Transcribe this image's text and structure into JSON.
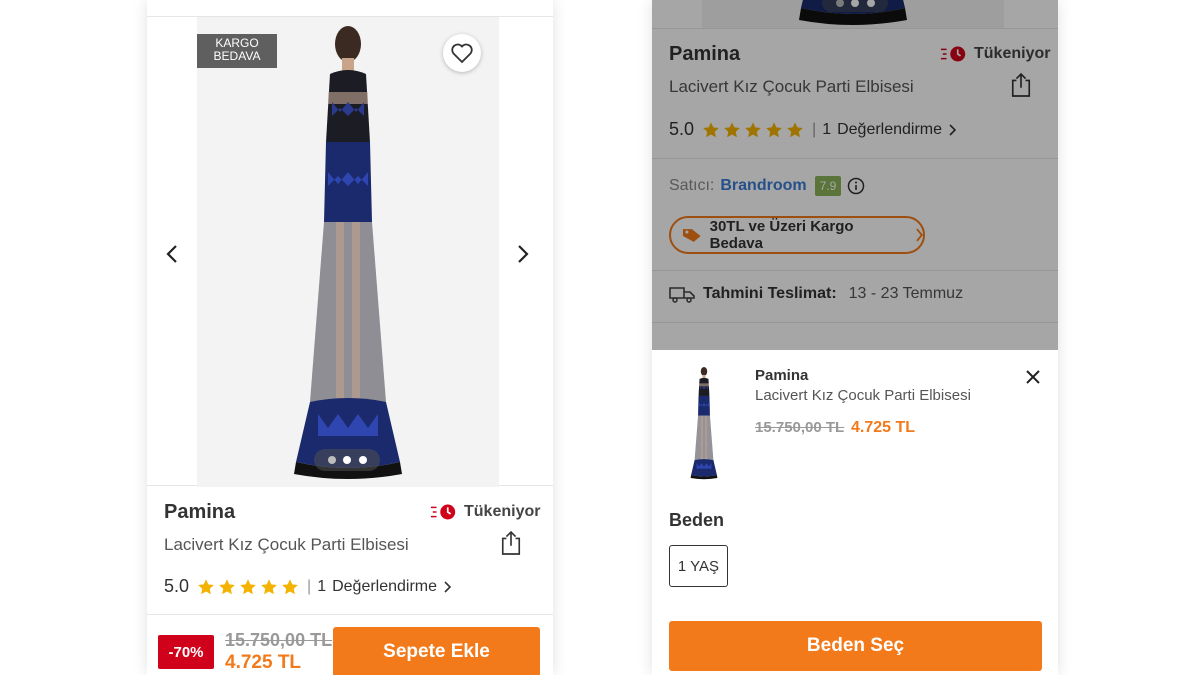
{
  "left": {
    "badge": {
      "line1": "KARGO",
      "line2": "BEDAVA"
    },
    "brand": "Pamina",
    "title": "Lacivert Kız Çocuk Parti Elbisesi",
    "stock_label": "Tükeniyor",
    "rating": {
      "value": "5.0",
      "stars": 5,
      "review_count": "1",
      "review_label": "Değerlendirme"
    },
    "discount": "-70%",
    "old_price": "15.750,00 TL",
    "new_price": "4.725 TL",
    "add_to_cart": "Sepete Ekle",
    "carousel": {
      "slides": 3,
      "active": 1
    }
  },
  "right": {
    "brand": "Pamina",
    "title": "Lacivert Kız Çocuk Parti Elbisesi",
    "stock_label": "Tükeniyor",
    "rating": {
      "value": "5.0",
      "stars": 5,
      "review_count": "1",
      "review_label": "Değerlendirme"
    },
    "seller": {
      "label": "Satıcı:",
      "name": "Brandroom",
      "score": "7.9"
    },
    "promo": "30TL ve Üzeri Kargo Bedava",
    "delivery": {
      "label": "Tahmini Teslimat:",
      "value": "13 - 23 Temmuz"
    },
    "sheet": {
      "brand": "Pamina",
      "title": "Lacivert Kız Çocuk Parti Elbisesi",
      "old_price": "15.750,00 TL",
      "new_price": "4.725 TL",
      "size_label": "Beden",
      "sizes": [
        "1 YAŞ"
      ],
      "select_button": "Beden Seç"
    }
  },
  "colors": {
    "accent": "#f27a1a",
    "discount": "#d0021b",
    "star": "#f5b301",
    "seller": "#3a7bd5",
    "score": "#8ab35a"
  }
}
